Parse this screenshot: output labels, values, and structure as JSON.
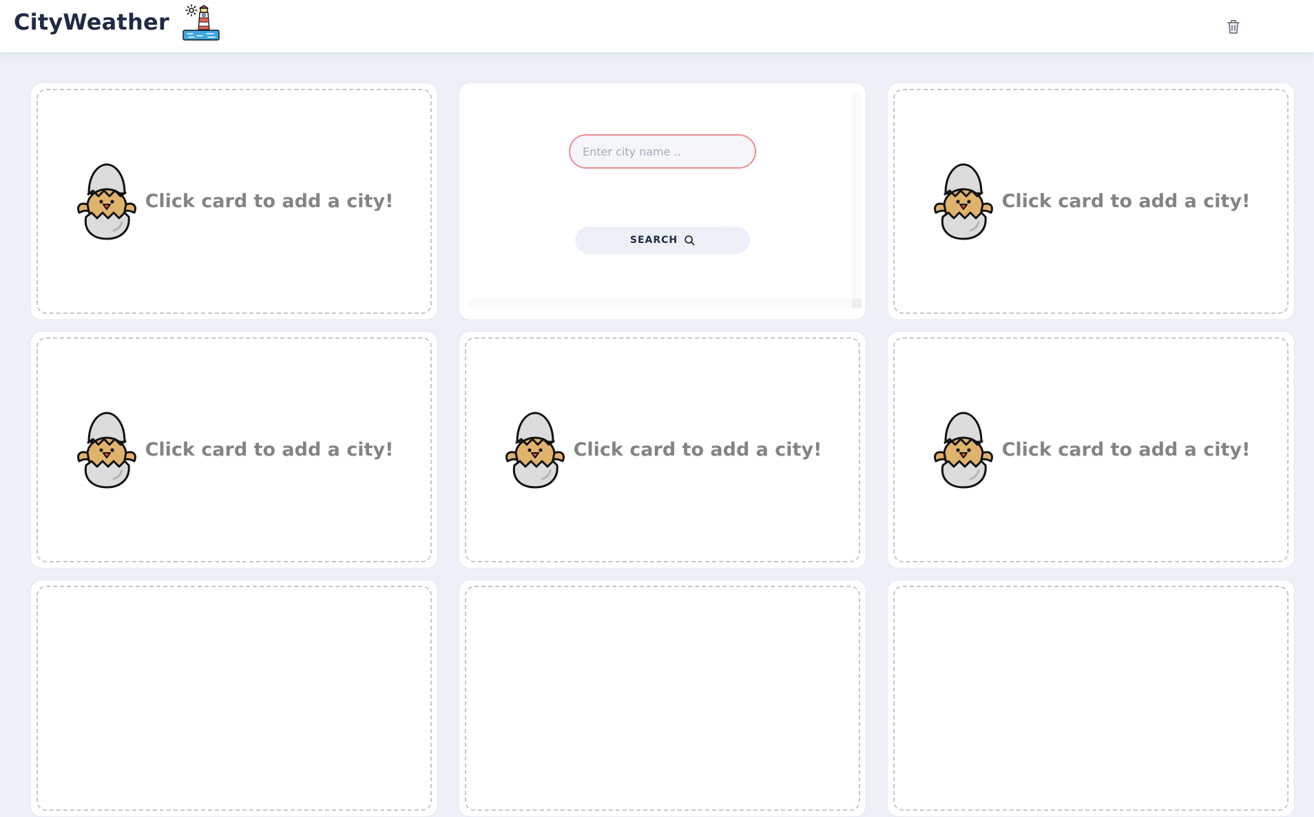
{
  "header": {
    "title": "CityWeather",
    "logo_icon": "lighthouse-icon",
    "clear_icon": "trash-icon"
  },
  "search": {
    "placeholder": "Enter city name ..",
    "value": "",
    "button_label": "SEARCH",
    "button_icon": "search-icon"
  },
  "cards": [
    {
      "label": "Click card to add a city!",
      "icon": "hatching-chick-icon"
    },
    {
      "label": "Click card to add a city!",
      "icon": "hatching-chick-icon"
    },
    {
      "label": "Click card to add a city!",
      "icon": "hatching-chick-icon"
    },
    {
      "label": "Click card to add a city!",
      "icon": "hatching-chick-icon"
    },
    {
      "label": "Click card to add a city!",
      "icon": "hatching-chick-icon"
    },
    {
      "label": "",
      "icon": ""
    },
    {
      "label": "",
      "icon": ""
    },
    {
      "label": "",
      "icon": ""
    }
  ],
  "colors": {
    "background": "#edf0f7",
    "title": "#1f2a44",
    "input_border": "#e98c8f",
    "placeholder_text": "#848484"
  }
}
